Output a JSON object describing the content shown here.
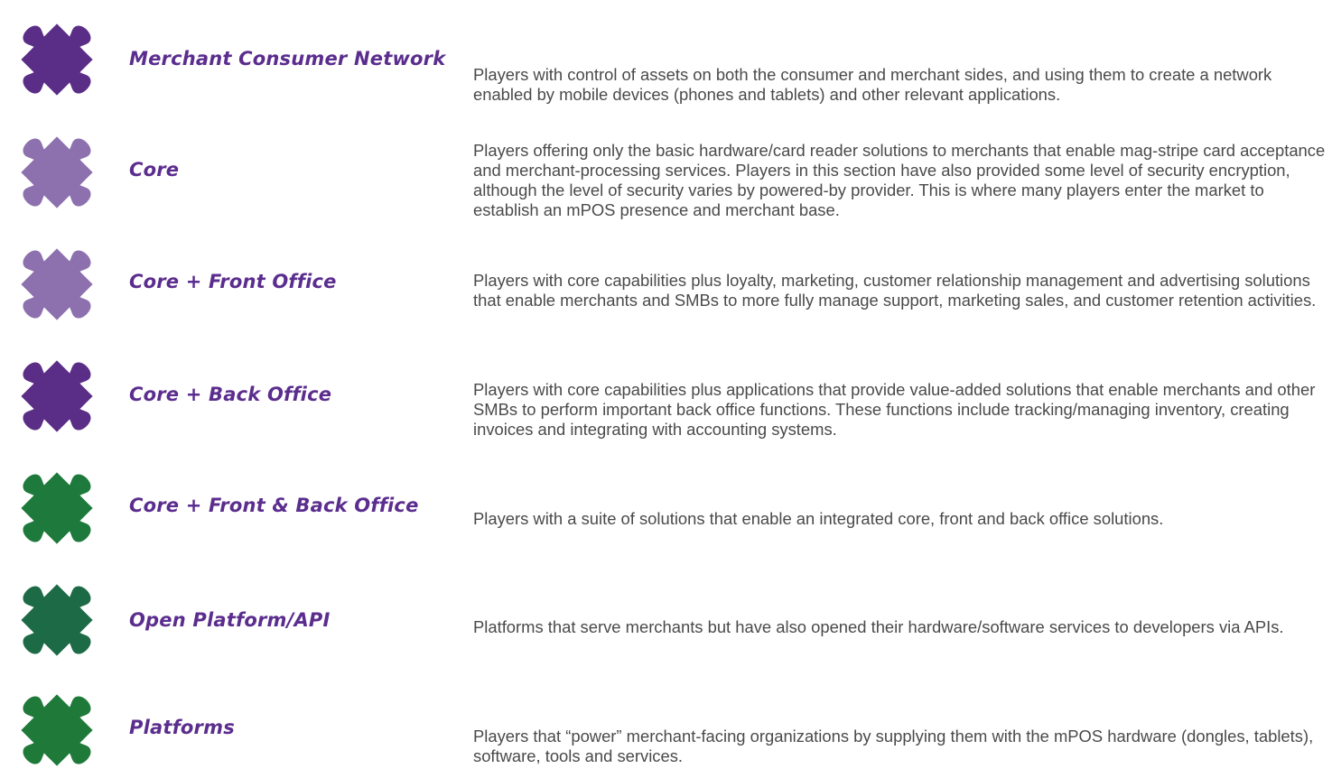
{
  "colors": {
    "label": "#5b2d8e",
    "text": "#4a4a4a"
  },
  "rows": [
    {
      "icon": "puzzle-piece-icon",
      "color": "#5a2d86",
      "label": "Merchant Consumer Network",
      "description": "Players with control of assets on both the consumer and merchant sides, and using them to create a network enabled by mobile devices (phones and tablets) and other relevant applications."
    },
    {
      "icon": "puzzle-piece-icon",
      "color": "#8d70ae",
      "label": "Core",
      "description": "Players offering only the basic hardware/card reader solutions to merchants that enable mag-stripe card acceptance and merchant-processing services. Players in this section have also provided some level of security encryption, although the level of security varies by powered-by provider. This is where many players enter the market to establish an mPOS presence and merchant base."
    },
    {
      "icon": "puzzle-piece-icon",
      "color": "#8d70ae",
      "label": "Core + Front Office",
      "description": "Players with core capabilities plus loyalty, marketing, customer relationship management and advertising solutions that enable merchants and SMBs to more fully manage support, marketing sales, and customer retention activities."
    },
    {
      "icon": "puzzle-piece-icon",
      "color": "#5a2d86",
      "label": "Core + Back Office",
      "description": "Players with core capabilities plus applications that provide value-added solutions that enable merchants and other SMBs to perform important back office functions. These functions include tracking/managing inventory, creating invoices and integrating with accounting systems."
    },
    {
      "icon": "puzzle-piece-icon",
      "color": "#1d7a3c",
      "label": "Core + Front & Back Office",
      "description": "Players with a suite of solutions that enable an integrated core, front and back office solutions."
    },
    {
      "icon": "puzzle-piece-icon",
      "color": "#1d6b46",
      "label": "Open Platform/API",
      "description": "Platforms that serve merchants but have also opened their hardware/software services to developers via APIs."
    },
    {
      "icon": "puzzle-piece-icon",
      "color": "#1f7a3a",
      "label": "Platforms",
      "description": "Players that “power” merchant-facing organizations by supplying them with the mPOS hardware (dongles, tablets), software, tools and services."
    }
  ]
}
